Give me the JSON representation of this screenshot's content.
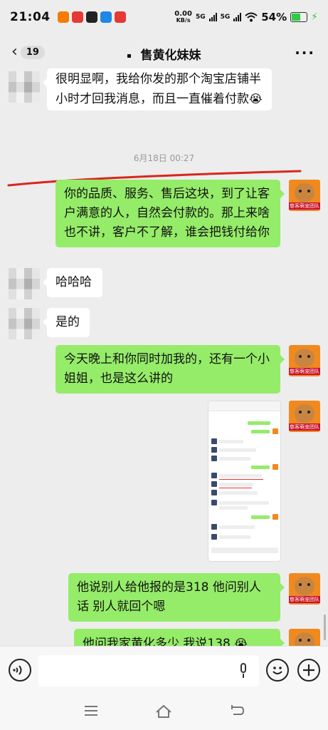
{
  "status_bar": {
    "time": "21:04",
    "net_speed_value": "0.00",
    "net_speed_unit": "KB/s",
    "signal1": "5G",
    "signal2": "5G",
    "battery": "54%",
    "app_icon_colors": [
      "#f57c00",
      "#e53935",
      "#222222",
      "#1e88e5",
      "#e53935"
    ]
  },
  "header": {
    "back_count": "19",
    "title": "售黄化妹妹",
    "more": "···"
  },
  "messages": [
    {
      "id": "m1",
      "side": "in",
      "text": "很明显啊，我给你发的那个淘宝店铺半小时才回我消息，而且一直催着付款",
      "emoji": "😭"
    },
    {
      "id": "ts",
      "type": "time",
      "text": "6月18日 00:27"
    },
    {
      "id": "m2",
      "side": "out",
      "text": "你的品质、服务、售后这块，到了让客户满意的人，自然会付款的。那上来啥也不讲，客户不了解，谁会把钱付给你"
    },
    {
      "id": "m3",
      "side": "in",
      "text": "哈哈哈"
    },
    {
      "id": "m4",
      "side": "in",
      "text": "是的"
    },
    {
      "id": "m5",
      "side": "out",
      "text": "今天晚上和你同时加我的，还有一个小姐姐，也是这么讲的"
    },
    {
      "id": "m6",
      "side": "out",
      "type": "image",
      "text": "[chat screenshot]"
    },
    {
      "id": "m7",
      "side": "out",
      "text": "他说别人给他报的是318 他问别人话  别人就回个嗯"
    },
    {
      "id": "m8",
      "side": "out",
      "text": "他问我家黄化多少  我说138",
      "emoji": "😭"
    }
  ],
  "avatar_self_label": "慈客萌宠团队",
  "input": {
    "placeholder": ""
  },
  "colors": {
    "out_bubble": "#95ec69",
    "in_bubble": "#ffffff",
    "background": "#ededed",
    "annotation": "#d9261c"
  }
}
